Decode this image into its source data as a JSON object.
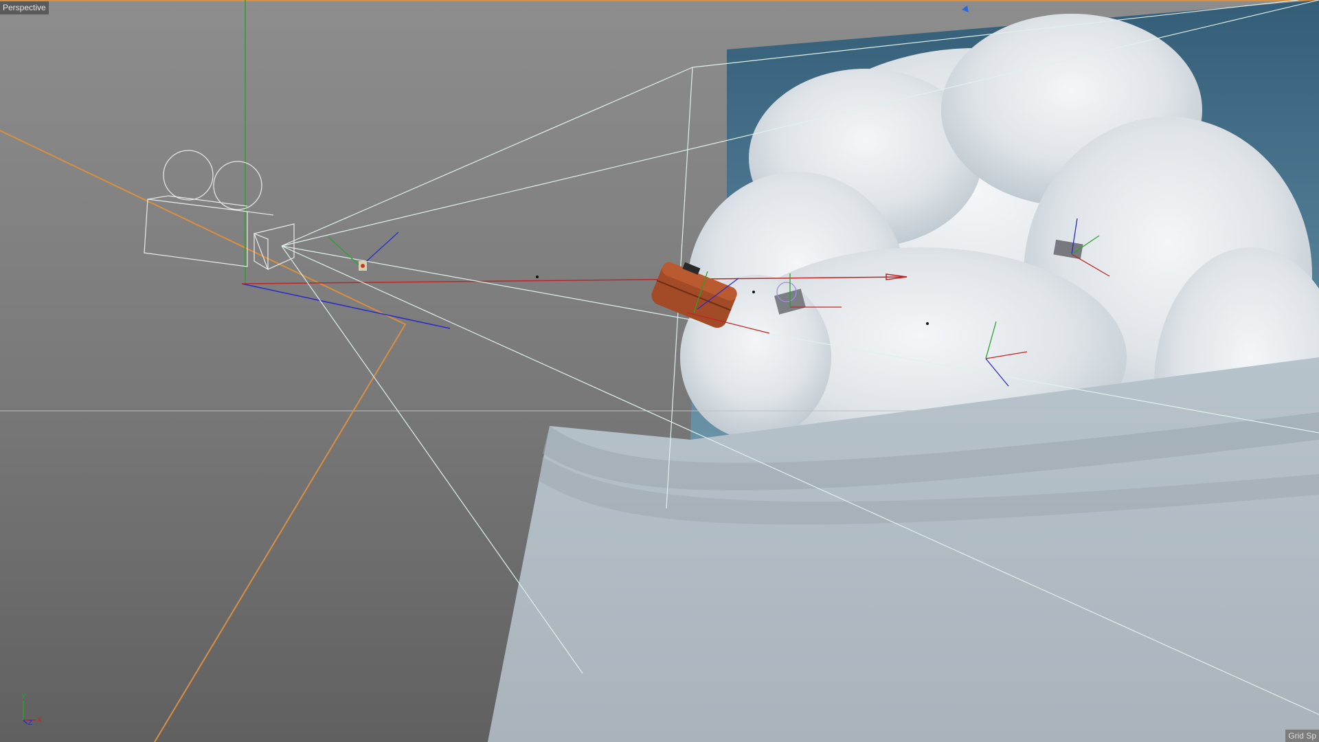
{
  "viewport": {
    "view_name": "Perspective",
    "grid_label": "Grid Sp",
    "axis_labels": {
      "x": "X",
      "y": "Y",
      "z": "Z"
    }
  },
  "colors": {
    "axis_x": "#c02424",
    "axis_y": "#2ca02c",
    "axis_z": "#2a2ac8",
    "camera_wire": "#e4e4e4",
    "frustum": "#e0f0ec",
    "orange_guide": "#d89040",
    "sky_top": "#3f6a84",
    "cloud": "#e8ecef"
  },
  "scene_objects": [
    {
      "name": "camera",
      "icon": "movie-camera-wireframe-icon"
    },
    {
      "name": "suitcase",
      "icon": "suitcase-object-icon"
    },
    {
      "name": "debris",
      "icon": "debris-object-icon"
    },
    {
      "name": "sky-backdrop",
      "icon": "sky-image-plane-icon"
    }
  ]
}
